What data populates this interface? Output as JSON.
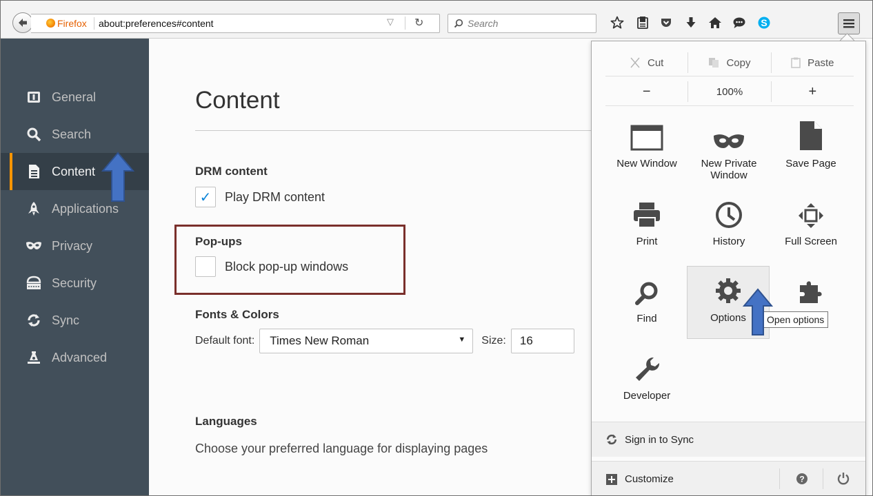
{
  "toolbar": {
    "identity_label": "Firefox",
    "url": "about:preferences#content",
    "search_placeholder": "Search"
  },
  "sidebar": {
    "items": [
      {
        "label": "General",
        "icon": "general-icon"
      },
      {
        "label": "Search",
        "icon": "search-icon"
      },
      {
        "label": "Content",
        "icon": "content-icon",
        "active": true
      },
      {
        "label": "Applications",
        "icon": "applications-icon"
      },
      {
        "label": "Privacy",
        "icon": "privacy-mask-icon"
      },
      {
        "label": "Security",
        "icon": "security-icon"
      },
      {
        "label": "Sync",
        "icon": "sync-icon"
      },
      {
        "label": "Advanced",
        "icon": "advanced-icon"
      }
    ]
  },
  "content": {
    "title": "Content",
    "drm": {
      "heading": "DRM content",
      "label": "Play DRM content",
      "checked": true
    },
    "popups": {
      "heading": "Pop-ups",
      "label": "Block pop-up windows",
      "checked": false
    },
    "fonts": {
      "heading": "Fonts & Colors",
      "default_font_label": "Default font:",
      "default_font_value": "Times New Roman",
      "size_label": "Size:",
      "size_value": "16"
    },
    "languages": {
      "heading": "Languages",
      "description": "Choose your preferred language for displaying pages"
    }
  },
  "menu_panel": {
    "edit": {
      "cut": "Cut",
      "copy": "Copy",
      "paste": "Paste"
    },
    "zoom": {
      "minus": "−",
      "level": "100%",
      "plus": "+"
    },
    "tiles": {
      "new_window": "New Window",
      "new_private_line1": "New Private",
      "new_private_line2": "Window",
      "save_page": "Save Page",
      "print": "Print",
      "history": "History",
      "full_screen": "Full Screen",
      "find": "Find",
      "options": "Options",
      "developer": "Developer"
    },
    "tooltip": "Open options",
    "sign_in": "Sign in to Sync",
    "customize": "Customize"
  },
  "colors": {
    "sidebar_bg": "#424f5a",
    "active_accent": "#ff9500",
    "annotation_box": "#7a2f2b",
    "annotation_arrow": "#3f6fb5"
  }
}
